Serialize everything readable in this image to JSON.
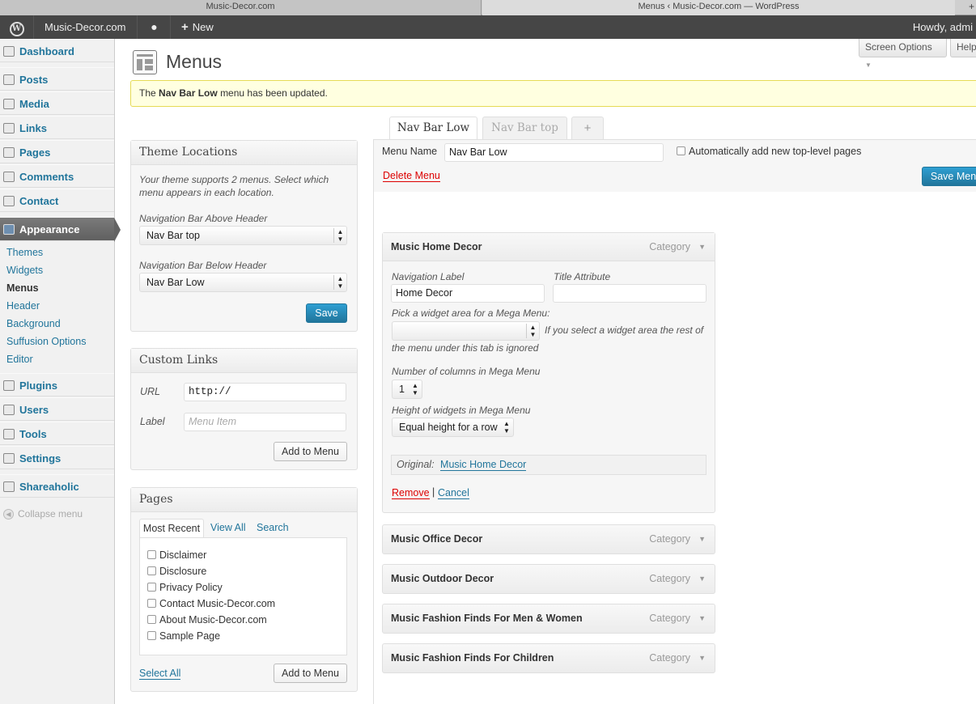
{
  "browser": {
    "tab1_title": "Music-Decor.com",
    "tab2_title": "Menus ‹ Music-Decor.com — WordPress",
    "new_tab_glyph": "+"
  },
  "adminbar": {
    "site_name": "Music-Decor.com",
    "new_label": "New",
    "howdy": "Howdy, admi"
  },
  "sidebar": {
    "items": [
      {
        "label": "Dashboard",
        "icon": "dashboard-icon"
      },
      {
        "label": "Posts",
        "icon": "pin-icon"
      },
      {
        "label": "Media",
        "icon": "media-icon"
      },
      {
        "label": "Links",
        "icon": "link-icon"
      },
      {
        "label": "Pages",
        "icon": "pages-icon"
      },
      {
        "label": "Comments",
        "icon": "comments-icon"
      },
      {
        "label": "Contact",
        "icon": "contact-icon"
      },
      {
        "label": "Appearance",
        "icon": "appearance-icon"
      },
      {
        "label": "Plugins",
        "icon": "plugin-icon"
      },
      {
        "label": "Users",
        "icon": "users-icon"
      },
      {
        "label": "Tools",
        "icon": "tools-icon"
      },
      {
        "label": "Settings",
        "icon": "settings-icon"
      },
      {
        "label": "Shareaholic",
        "icon": "shareaholic-icon"
      }
    ],
    "appearance_submenu": [
      "Themes",
      "Widgets",
      "Menus",
      "Header",
      "Background",
      "Suffusion Options",
      "Editor"
    ],
    "collapse_label": "Collapse menu"
  },
  "top_buttons": {
    "screen_options": "Screen Options",
    "help": "Help"
  },
  "page": {
    "title": "Menus",
    "notice_prefix": "The",
    "notice_menu": "Nav Bar Low",
    "notice_suffix": "menu has been updated."
  },
  "theme_locations": {
    "title": "Theme Locations",
    "description": "Your theme supports 2 menus. Select which menu appears in each location.",
    "above_label": "Navigation Bar Above Header",
    "above_value": "Nav Bar top",
    "below_label": "Navigation Bar Below Header",
    "below_value": "Nav Bar Low",
    "save_label": "Save"
  },
  "custom_links": {
    "title": "Custom Links",
    "url_label": "URL",
    "url_value": "http://",
    "label_label": "Label",
    "label_placeholder": "Menu Item",
    "add_label": "Add to Menu"
  },
  "pages_box": {
    "title": "Pages",
    "tabs": [
      "Most Recent",
      "View All",
      "Search"
    ],
    "pages": [
      "Disclaimer",
      "Disclosure",
      "Privacy Policy",
      "Contact Music-Decor.com",
      "About Music-Decor.com",
      "Sample Page"
    ],
    "select_all": "Select All",
    "add_label": "Add to Menu"
  },
  "menu_tabs": {
    "active": "Nav Bar Low",
    "inactive": "Nav Bar top",
    "add": "+"
  },
  "menu_editor": {
    "name_label": "Menu Name",
    "name_value": "Nav Bar Low",
    "auto_add_label": "Automatically add new top-level pages",
    "delete_label": "Delete Menu",
    "save_label": "Save Menu"
  },
  "expanded_item": {
    "title": "Music Home Decor",
    "type": "Category",
    "nav_label_label": "Navigation Label",
    "nav_label_value": "Home Decor",
    "title_attr_label": "Title Attribute",
    "title_attr_value": "",
    "widget_area_label": "Pick a widget area for a Mega Menu:",
    "widget_area_note_1": "If you select a widget area the rest of",
    "widget_area_note_2": "the menu under this tab is ignored",
    "columns_label": "Number of columns in Mega Menu",
    "columns_value": "1",
    "height_label": "Height of widgets in Mega Menu",
    "height_value": "Equal height for a row",
    "original_label": "Original:",
    "original_link": "Music Home Decor",
    "remove_label": "Remove",
    "separator": "|",
    "cancel_label": "Cancel"
  },
  "menu_items": [
    {
      "title": "Music Office Decor",
      "type": "Category"
    },
    {
      "title": "Music Outdoor Decor",
      "type": "Category"
    },
    {
      "title": "Music Fashion Finds For Men & Women",
      "type": "Category"
    },
    {
      "title": "Music Fashion Finds For Children",
      "type": "Category"
    }
  ]
}
